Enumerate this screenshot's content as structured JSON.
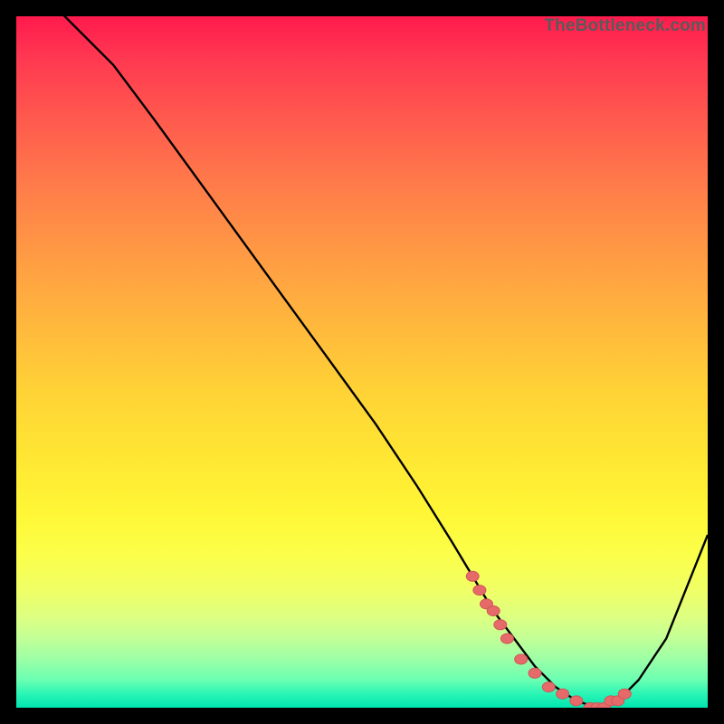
{
  "watermark": "TheBottleneck.com",
  "colors": {
    "curve": "#000000",
    "marker_fill": "#e66a6a",
    "marker_stroke": "#d05656",
    "background_black": "#000000"
  },
  "chart_data": {
    "type": "line",
    "title": "",
    "xlabel": "",
    "ylabel": "",
    "xlim": [
      0,
      100
    ],
    "ylim": [
      0,
      100
    ],
    "grid": false,
    "legend": false,
    "series": [
      {
        "name": "bottleneck-curve",
        "x": [
          0,
          4,
          8,
          14,
          20,
          28,
          36,
          44,
          52,
          58,
          63,
          66,
          69,
          72,
          75,
          78,
          81,
          84,
          87,
          90,
          94,
          100
        ],
        "values": [
          105,
          103,
          99,
          93,
          85,
          74,
          63,
          52,
          41,
          32,
          24,
          19,
          14,
          10,
          6,
          3,
          1,
          0,
          1,
          4,
          10,
          25
        ]
      }
    ],
    "markers": {
      "name": "highlight-points",
      "x": [
        66,
        67,
        68,
        69,
        70,
        71,
        73,
        75,
        77,
        79,
        81,
        83,
        84,
        85,
        86,
        87,
        88
      ],
      "values": [
        19,
        17,
        15,
        14,
        12,
        10,
        7,
        5,
        3,
        2,
        1,
        0,
        0,
        0,
        1,
        1,
        2
      ]
    }
  }
}
